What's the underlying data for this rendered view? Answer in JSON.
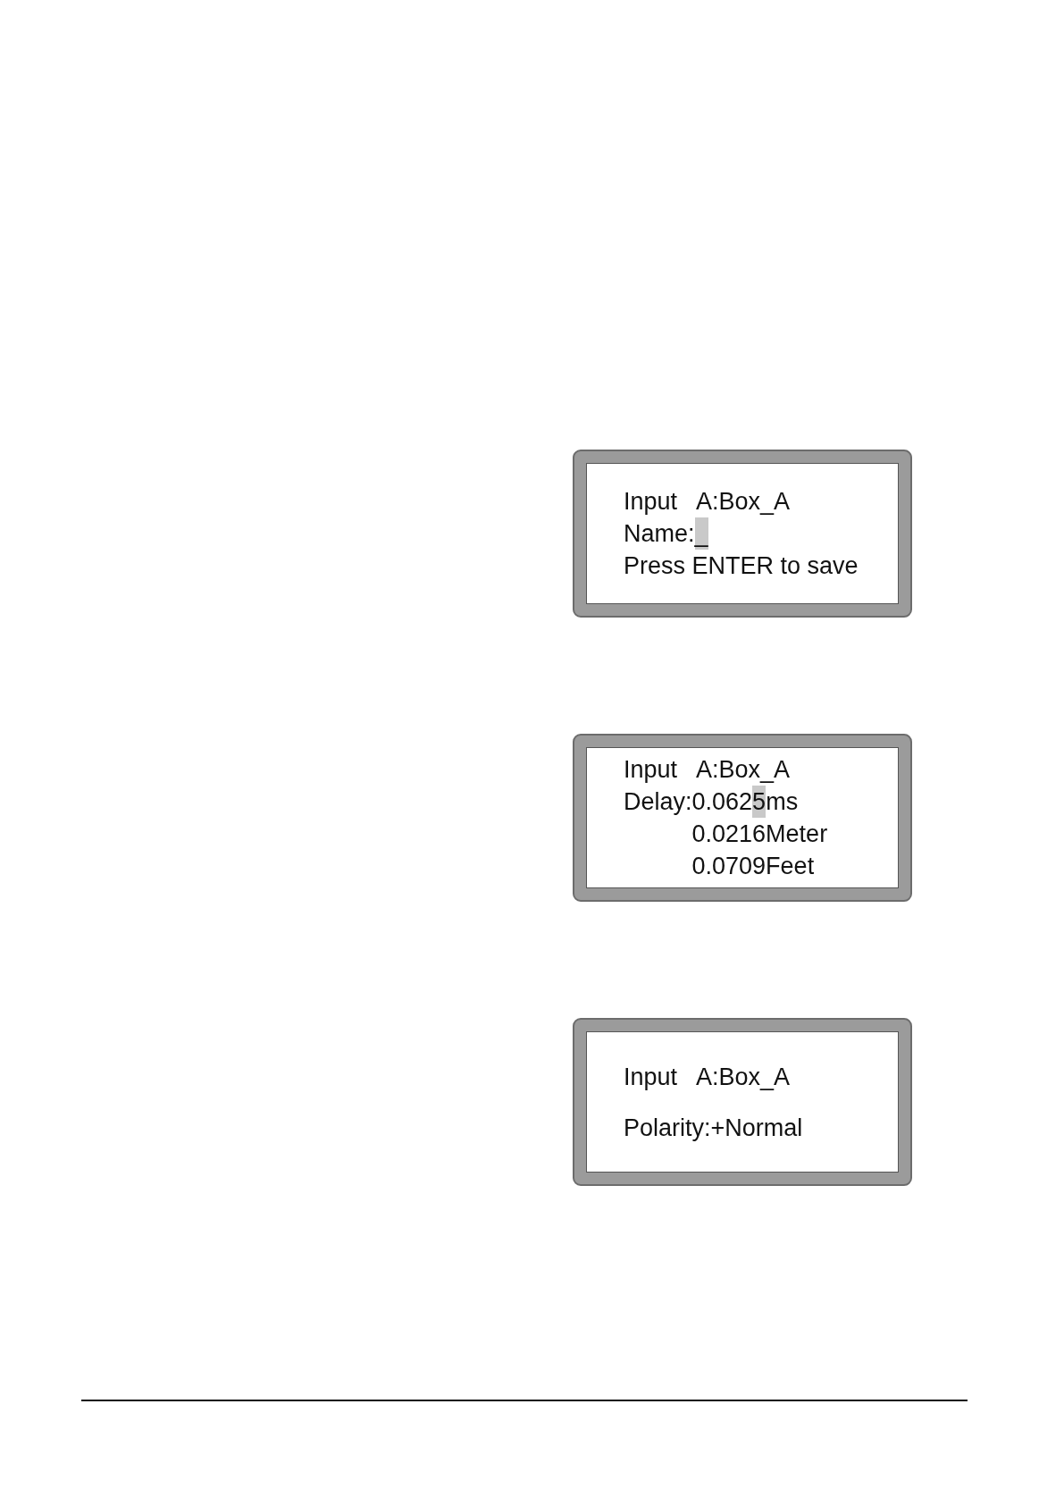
{
  "screens": [
    {
      "title": "Input   A:Box_A",
      "fields": [
        {
          "label": "Name:",
          "values": [
            {
              "segments": [
                {
                  "text": "_",
                  "selected": true
                }
              ]
            }
          ]
        }
      ],
      "hint": "Press ENTER to save"
    },
    {
      "title": "Input   A:Box_A",
      "fields": [
        {
          "label": "Delay:",
          "values": [
            {
              "segments": [
                {
                  "text": "0.062",
                  "selected": false
                },
                {
                  "text": "5",
                  "selected": true
                },
                {
                  "text": "ms",
                  "selected": false
                }
              ]
            },
            {
              "segments": [
                {
                  "text": "0.0216Meter",
                  "selected": false
                }
              ]
            },
            {
              "segments": [
                {
                  "text": "0.0709Feet",
                  "selected": false
                }
              ]
            }
          ]
        }
      ]
    },
    {
      "title": "Input   A:Box_A",
      "fields": [
        {
          "label": "Polarity:",
          "values": [
            {
              "segments": [
                {
                  "text": "+Normal",
                  "selected": false
                }
              ]
            }
          ]
        }
      ]
    }
  ]
}
